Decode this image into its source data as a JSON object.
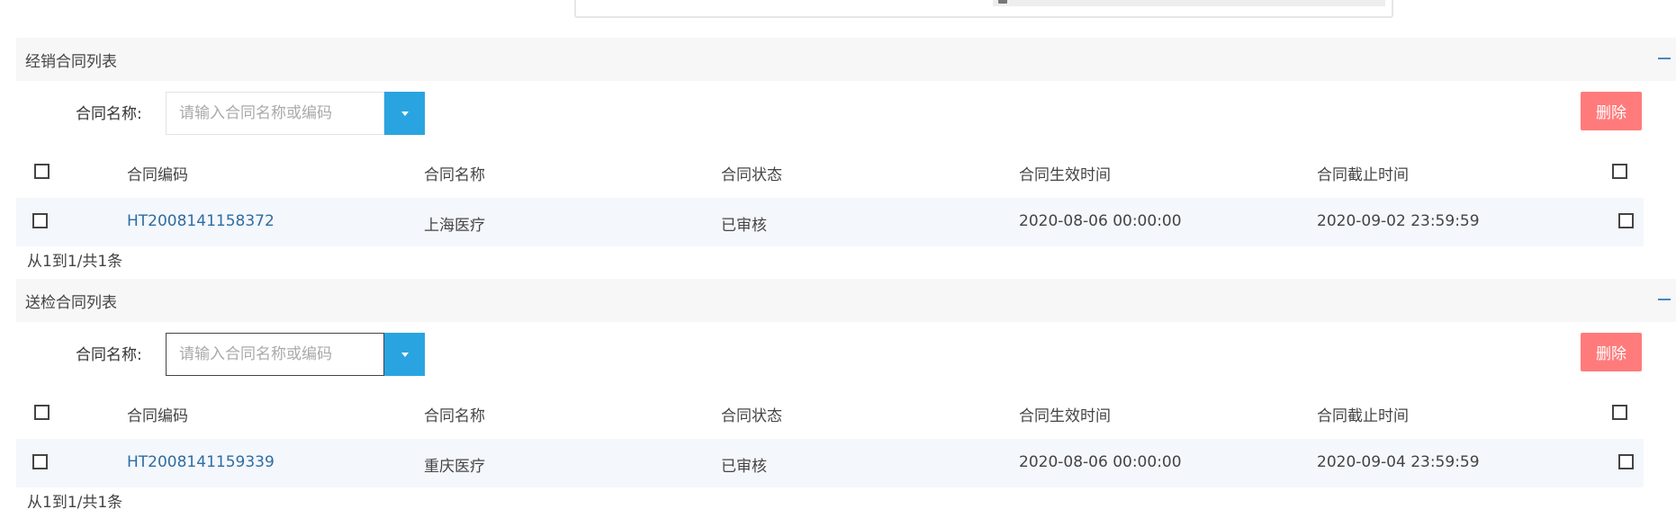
{
  "colors": {
    "accent": "#2aa4e0",
    "danger": "#ff7b7b",
    "link": "#2e6da4",
    "header_bg": "#f7f7f7",
    "row_bg": "#f4f7fb"
  },
  "icons": {
    "collapse": "minus-icon",
    "dropdown": "caret-down-icon"
  },
  "panels": [
    {
      "title": "经销合同列表",
      "filter": {
        "label": "合同名称:",
        "placeholder": "请输入合同名称或编码",
        "value": ""
      },
      "delete_label": "删除",
      "columns": [
        "合同编码",
        "合同名称",
        "合同状态",
        "合同生效时间",
        "合同截止时间"
      ],
      "rows": [
        {
          "code": "HT2008141158372",
          "name": "上海医疗",
          "status": "已审核",
          "start": "2020-08-06 00:00:00",
          "end": "2020-09-02 23:59:59"
        }
      ],
      "pagination": "从1到1/共1条"
    },
    {
      "title": "送检合同列表",
      "filter": {
        "label": "合同名称:",
        "placeholder": "请输入合同名称或编码",
        "value": ""
      },
      "delete_label": "删除",
      "columns": [
        "合同编码",
        "合同名称",
        "合同状态",
        "合同生效时间",
        "合同截止时间"
      ],
      "rows": [
        {
          "code": "HT2008141159339",
          "name": "重庆医疗",
          "status": "已审核",
          "start": "2020-08-06 00:00:00",
          "end": "2020-09-04 23:59:59"
        }
      ],
      "pagination": "从1到1/共1条"
    }
  ]
}
